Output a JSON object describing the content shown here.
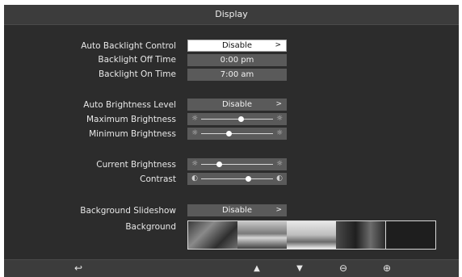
{
  "title": "Display",
  "rows": {
    "auto_backlight": {
      "label": "Auto Backlight Control",
      "value": "Disable",
      "chevron": ">"
    },
    "backlight_off": {
      "label": "Backlight Off Time",
      "value": "0:00 pm"
    },
    "backlight_on": {
      "label": "Backlight On Time",
      "value": "7:00 am"
    },
    "auto_brightness": {
      "label": "Auto Brightness Level",
      "value": "Disable",
      "chevron": ">"
    },
    "max_brightness": {
      "label": "Maximum Brightness",
      "level_pct": 55,
      "icon_left": "sun-small-icon",
      "icon_right": "sun-large-icon"
    },
    "min_brightness": {
      "label": "Minimum Brightness",
      "level_pct": 38,
      "icon_left": "sun-small-icon",
      "icon_right": "sun-large-icon"
    },
    "current_brightness": {
      "label": "Current Brightness",
      "level_pct": 25,
      "icon_left": "sun-small-icon",
      "icon_right": "sun-large-icon"
    },
    "contrast": {
      "label": "Contrast",
      "level_pct": 65,
      "icon_left": "contrast-icon",
      "icon_right": "contrast-icon"
    },
    "slideshow": {
      "label": "Background Slideshow",
      "value": "Disable",
      "chevron": ">"
    },
    "background": {
      "label": "Background"
    }
  },
  "bottom_bar": {
    "back": "back-icon",
    "up": "up-arrow-icon",
    "down": "down-arrow-icon",
    "minus": "minus-icon",
    "plus": "plus-icon"
  },
  "glyphs": {
    "back": "↩",
    "up": "▲",
    "down": "▼",
    "minus": "⊖",
    "plus": "⊕",
    "sun": "☼",
    "contrast": "◐"
  }
}
